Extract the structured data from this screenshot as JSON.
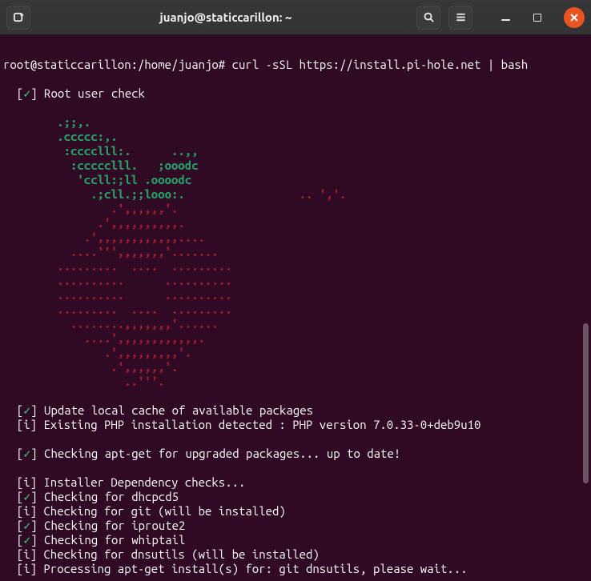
{
  "titlebar": {
    "title": "juanjo@staticcarillon: ~",
    "icons": {
      "new_tab": "new-tab-icon",
      "search": "search-icon",
      "menu": "hamburger-icon",
      "minimize": "minimize-icon",
      "maximize": "maximize-icon",
      "close": "close-icon"
    }
  },
  "prompt": {
    "user_host": "root@staticcarillon",
    "path": ":/home/juanjo#",
    "command": " curl -sSL https://install.pi-hole.net | bash"
  },
  "checks": {
    "root": "Root user check",
    "update_cache": "Update local cache of available packages",
    "php_detected": "Existing PHP installation detected : PHP version 7.0.33-0+deb9u10",
    "apt_upgraded": "Checking apt-get for upgraded packages... up to date!",
    "dep_checks": "Installer Dependency checks...",
    "dhcpcd5": "Checking for dhcpcd5",
    "git": "Checking for git (will be installed)",
    "iproute2": "Checking for iproute2",
    "whiptail": "Checking for whiptail",
    "dnsutils": "Checking for dnsutils (will be installed)",
    "processing": "Processing apt-get install(s) for: git dnsutils, please wait..."
  },
  "status_markers": {
    "ok_open": "  [",
    "ok_check": "✓",
    "ok_close": "] ",
    "info": "  [i] "
  },
  "ascii_green": [
    "        .;;,.",
    "        .ccccc:,.",
    "         :cccclll:.      ..,,",
    "          :ccccclll.   ;ooodc",
    "           'ccll:;ll .oooodc",
    "             .;cll.;;looo:."
  ],
  "ascii_red": [
    "                 .. ','.",
    "                .',,,,,,'.",
    "              .',,,,,,,,,,.",
    "            .',,,,,,,,,,,,....",
    "          ....''',,,,,,,'.......",
    "        .........  ....  .........",
    "        ..........      ..........",
    "        ..........      ..........",
    "        .........  ....  .........",
    "          ........,,,,,,,'......",
    "            ....',,,,,,,,,,,,.",
    "               .',,,,,,,,,'.",
    "                .',,,,,,'.",
    "                  ..'''."
  ]
}
